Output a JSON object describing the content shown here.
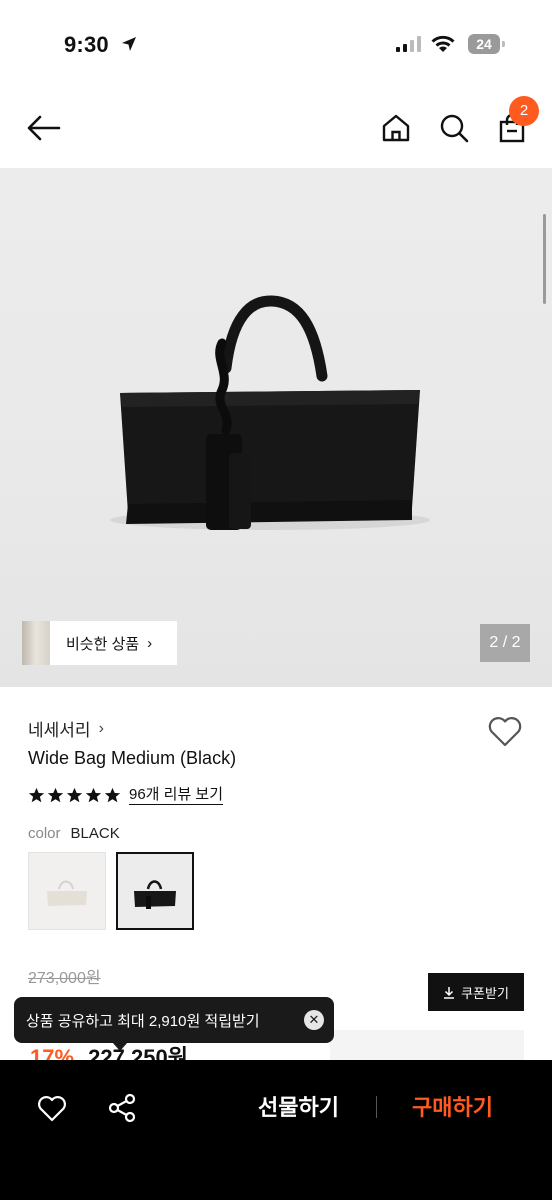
{
  "status": {
    "time": "9:30",
    "battery": "24"
  },
  "nav": {
    "cart_count": "2"
  },
  "gallery": {
    "similar_label": "비슷한 상품",
    "counter": "2 / 2"
  },
  "product": {
    "brand": "네세서리",
    "name": "Wide Bag Medium (Black)",
    "rating_stars": 5,
    "review_link": "96개 리뷰 보기",
    "color_label": "color",
    "color_value": "BLACK",
    "original_price": "273,000원",
    "discount_partial": "17%",
    "sale_price_partial": "227,250원"
  },
  "coupon": {
    "label": "쿠폰받기"
  },
  "toast": {
    "text": "상품 공유하고 최대 2,910원 적립받기"
  },
  "bottom_bar": {
    "gift_label": "선물하기",
    "buy_label": "구매하기"
  },
  "colors": {
    "accent": "#ff5a1f",
    "dark": "#111111"
  }
}
